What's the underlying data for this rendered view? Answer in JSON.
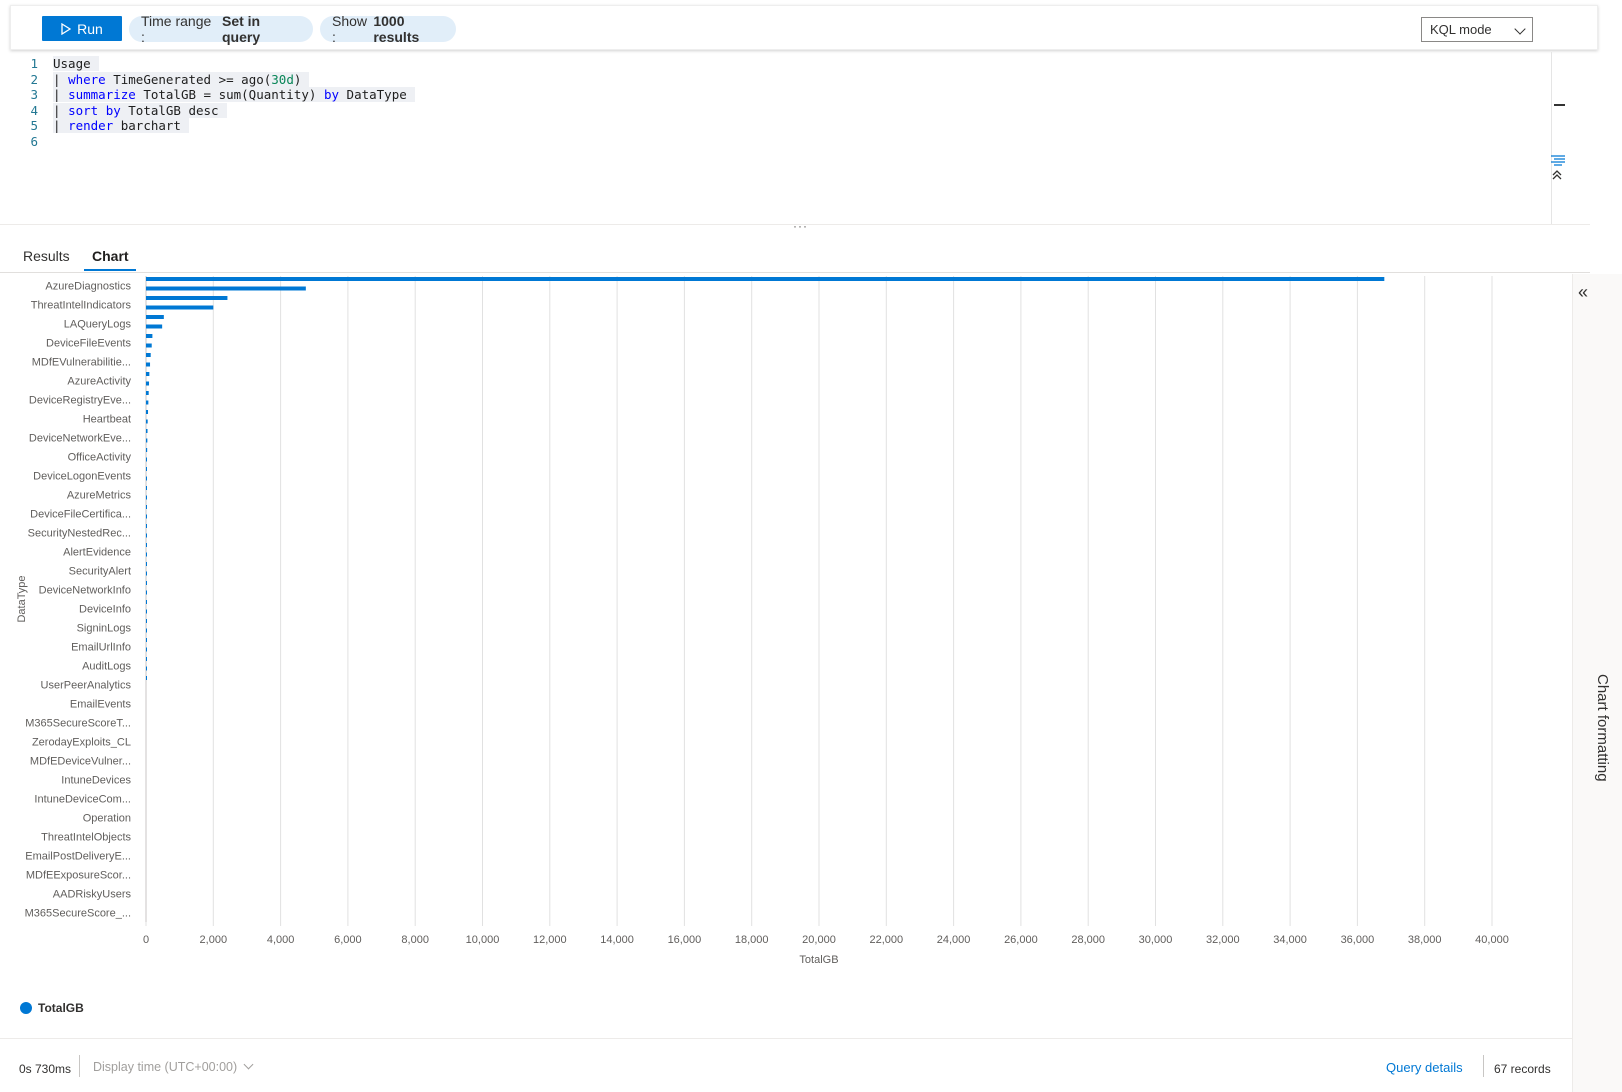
{
  "toolbar": {
    "run_label": "Run",
    "time_range_label": "Time range :",
    "time_range_value": "Set in query",
    "show_label": "Show :",
    "show_value": "1000 results",
    "mode": "KQL mode"
  },
  "editor": {
    "lines": [
      {
        "n": "1",
        "tokens": [
          {
            "t": "Usage",
            "c": "id"
          }
        ]
      },
      {
        "n": "2",
        "tokens": [
          {
            "t": "| ",
            "c": "id"
          },
          {
            "t": "where",
            "c": "kw"
          },
          {
            "t": " TimeGenerated >= ago(",
            "c": "id"
          },
          {
            "t": "30d",
            "c": "num"
          },
          {
            "t": ")",
            "c": "id"
          }
        ]
      },
      {
        "n": "3",
        "tokens": [
          {
            "t": "| ",
            "c": "id"
          },
          {
            "t": "summarize",
            "c": "kw"
          },
          {
            "t": " TotalGB = sum(Quantity) ",
            "c": "id"
          },
          {
            "t": "by",
            "c": "kw"
          },
          {
            "t": " DataType",
            "c": "id"
          }
        ]
      },
      {
        "n": "4",
        "tokens": [
          {
            "t": "| ",
            "c": "id"
          },
          {
            "t": "sort by",
            "c": "kw"
          },
          {
            "t": " TotalGB desc",
            "c": "id"
          }
        ]
      },
      {
        "n": "5",
        "tokens": [
          {
            "t": "| ",
            "c": "id"
          },
          {
            "t": "render",
            "c": "kw"
          },
          {
            "t": " barchart",
            "c": "id"
          }
        ]
      },
      {
        "n": "6",
        "tokens": []
      }
    ]
  },
  "tabs": {
    "results": "Results",
    "chart": "Chart"
  },
  "side_panel": {
    "label": "Chart formatting"
  },
  "status": {
    "elapsed": "0s 730ms",
    "display_time": "Display time (UTC+00:00)",
    "query_details": "Query details",
    "records": "67 records"
  },
  "colors": {
    "accent": "#0078d4",
    "bar": "#0078d4"
  },
  "icons": [
    "play-icon",
    "chevron-down-icon",
    "wrap-icon",
    "collapse-up-icon",
    "collapse-panel-icon"
  ],
  "chart_data": {
    "type": "bar",
    "orientation": "horizontal",
    "xlabel": "TotalGB",
    "ylabel": "DataType",
    "xlim": [
      0,
      40000
    ],
    "xticks": [
      "0",
      "2,000",
      "4,000",
      "6,000",
      "8,000",
      "10,000",
      "12,000",
      "14,000",
      "16,000",
      "18,000",
      "20,000",
      "22,000",
      "24,000",
      "26,000",
      "28,000",
      "30,000",
      "32,000",
      "34,000",
      "36,000",
      "38,000",
      "40,000"
    ],
    "grid": true,
    "legend_position": "bottom-left",
    "categories": [
      "AzureDiagnostics",
      "ThreatIntelIndicators",
      "LAQueryLogs",
      "DeviceFileEvents",
      "MDfEVulnerabilitie...",
      "AzureActivity",
      "DeviceRegistryEve...",
      "Heartbeat",
      "DeviceNetworkEve...",
      "OfficeActivity",
      "DeviceLogonEvents",
      "AzureMetrics",
      "DeviceFileCertifica...",
      "SecurityNestedRec...",
      "AlertEvidence",
      "SecurityAlert",
      "DeviceNetworkInfo",
      "DeviceInfo",
      "SigninLogs",
      "EmailUrlInfo",
      "AuditLogs",
      "UserPeerAnalytics",
      "EmailEvents",
      "M365SecureScoreT...",
      "ZerodayExploits_CL",
      "MDfEDeviceVulner...",
      "IntuneDevices",
      "IntuneDeviceCom...",
      "Operation",
      "ThreatIntelObjects",
      "EmailPostDeliveryE...",
      "MDfEExposureScor...",
      "AADRiskyUsers",
      "M365SecureScore_..."
    ],
    "series": [
      {
        "name": "TotalGB",
        "values": [
          36800,
          4750,
          2420,
          2000,
          530,
          480,
          190,
          170,
          140,
          120,
          100,
          90,
          80,
          70,
          60,
          50,
          45,
          40,
          35,
          30,
          25,
          20,
          18,
          15,
          12,
          10,
          9,
          8,
          7,
          6,
          5,
          4,
          3,
          2,
          2,
          1,
          1,
          1,
          1,
          1,
          1,
          1,
          1,
          0,
          0,
          0,
          0,
          0,
          0,
          0,
          0,
          0,
          0,
          0,
          0,
          0,
          0,
          0,
          0,
          0,
          0,
          0,
          0,
          0,
          0,
          0,
          0
        ]
      }
    ]
  }
}
